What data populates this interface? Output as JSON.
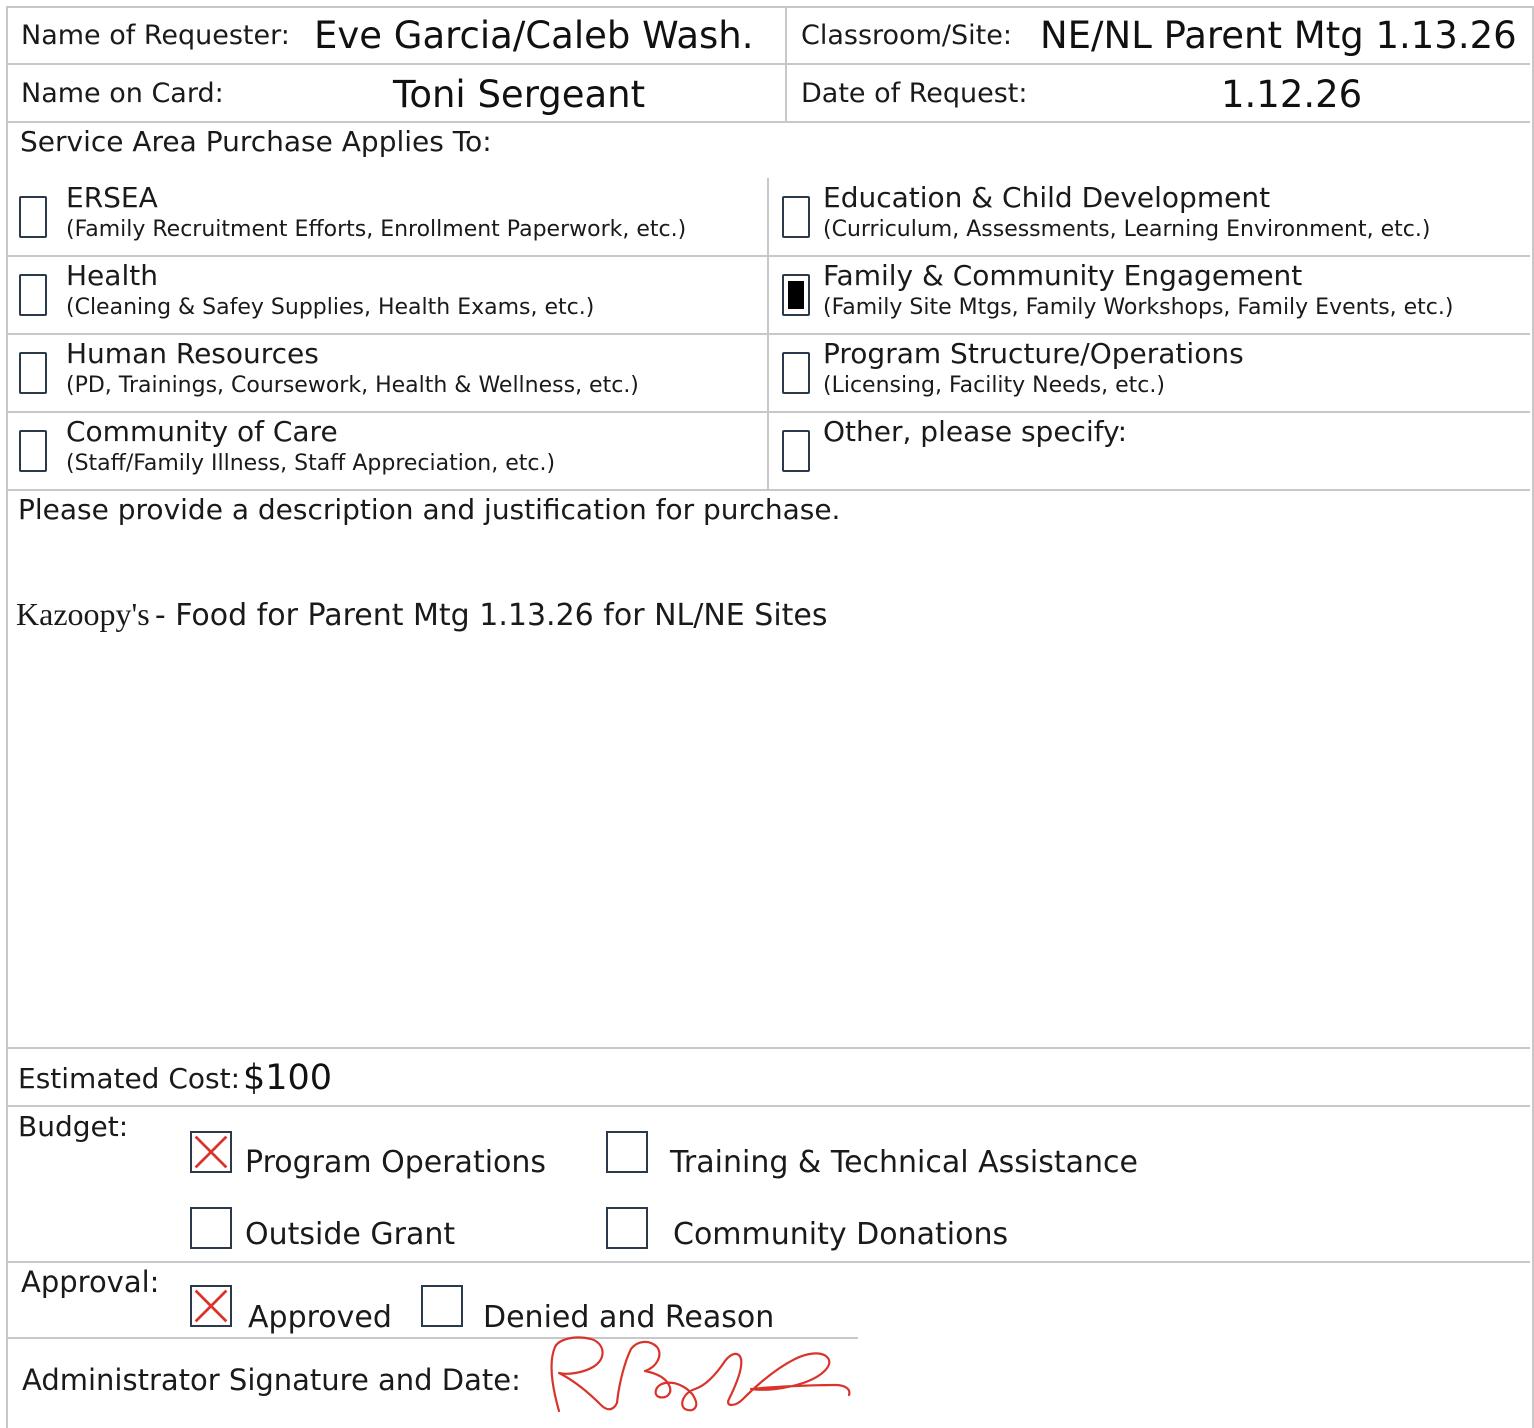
{
  "header": {
    "requester_label": "Name of Requester:",
    "requester_value": "Eve Garcia/Caleb Wash.",
    "site_label": "Classroom/Site:",
    "site_value": "NE/NL Parent Mtg 1.13.26",
    "card_label": "Name on Card:",
    "card_value": "Toni Sergeant",
    "date_label": "Date of Request:",
    "date_value": "1.12.26"
  },
  "service_area": {
    "heading": "Service Area Purchase Applies To:",
    "options": [
      {
        "title": "ERSEA",
        "sub": "(Family Recruitment Efforts, Enrollment Paperwork, etc.)",
        "checked": false
      },
      {
        "title": "Education & Child Development",
        "sub": "(Curriculum, Assessments, Learning Environment, etc.)",
        "checked": false
      },
      {
        "title": "Health",
        "sub": "(Cleaning & Safey Supplies, Health Exams, etc.)",
        "checked": false
      },
      {
        "title": "Family & Community Engagement",
        "sub": "(Family Site Mtgs, Family Workshops, Family Events, etc.)",
        "checked": true
      },
      {
        "title": "Human Resources",
        "sub": "(PD, Trainings, Coursework, Health & Wellness, etc.)",
        "checked": false
      },
      {
        "title": "Program Structure/Operations",
        "sub": "(Licensing, Facility Needs, etc.)",
        "checked": false
      },
      {
        "title": "Community of Care",
        "sub": "(Staff/Family Illness, Staff Appreciation, etc.)",
        "checked": false
      },
      {
        "title": "Other, please specify:",
        "sub": "",
        "checked": false
      }
    ]
  },
  "description": {
    "prompt": "Please provide a description and justification for purchase.",
    "vendor": "Kazoopy's",
    "text": "- Food for Parent Mtg 1.13.26 for NL/NE Sites"
  },
  "cost": {
    "label": "Estimated Cost:",
    "value": "$100"
  },
  "budget": {
    "label": "Budget:",
    "options": [
      {
        "label": "Program Operations",
        "checked": true
      },
      {
        "label": "Training & Technical Assistance",
        "checked": false
      },
      {
        "label": "Outside Grant",
        "checked": false
      },
      {
        "label": "Community Donations",
        "checked": false
      }
    ]
  },
  "approval": {
    "label": "Approval:",
    "approved_label": "Approved",
    "approved_checked": true,
    "denied_label": "Denied and Reason",
    "denied_checked": false
  },
  "signature": {
    "label": "Administrator Signature and Date:"
  },
  "colors": {
    "check_mark": "#d9342b",
    "signature_ink": "#d9342b",
    "checkbox_border": "#2b3a4a",
    "grid_line": "#c8c8c8"
  }
}
